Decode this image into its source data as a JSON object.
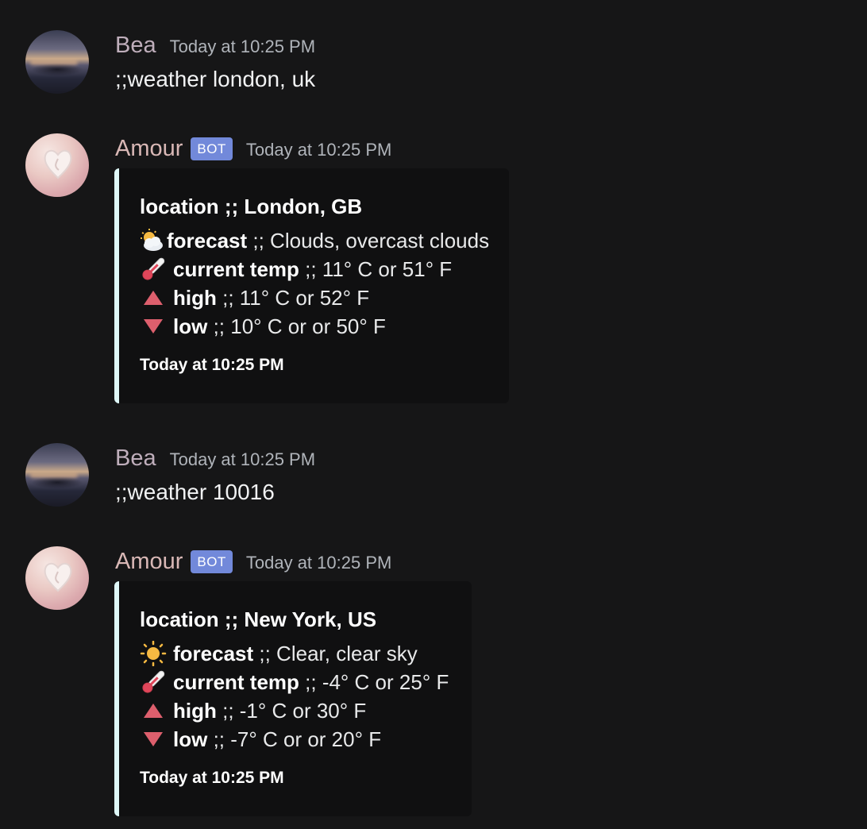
{
  "messages": [
    {
      "author": "Bea",
      "time": "Today at 10:25 PM",
      "text": ";;weather london, uk"
    },
    {
      "author": "Amour",
      "bot_tag": "BOT",
      "time": "Today at 10:25 PM",
      "embed": {
        "accent_color": "#dff8f8",
        "title": "location ;; London, GB",
        "forecast_label": "forecast",
        "forecast_value": " ;; Clouds, overcast clouds",
        "forecast_icon": "sun-behind-cloud-icon",
        "current_label": "current temp",
        "current_value": " ;; 11° C or 51° F",
        "high_label": "high",
        "high_value": " ;; 11° C or 52° F",
        "low_label": "low",
        "low_value": " ;; 10° C or or 50° F",
        "footer": "Today at 10:25 PM"
      }
    },
    {
      "author": "Bea",
      "time": "Today at 10:25 PM",
      "text": ";;weather 10016"
    },
    {
      "author": "Amour",
      "bot_tag": "BOT",
      "time": "Today at 10:25 PM",
      "embed": {
        "accent_color": "#dff8f8",
        "title": "location ;; New York, US",
        "forecast_label": "forecast",
        "forecast_value": " ;; Clear, clear sky",
        "forecast_icon": "sun-icon",
        "current_label": "current temp",
        "current_value": " ;; -4° C or 25° F",
        "high_label": "high",
        "high_value": " ;; -1° C or 30° F",
        "low_label": "low",
        "low_value": " ;; -7° C or or 20° F",
        "footer": "Today at 10:25 PM"
      }
    }
  ],
  "colors": {
    "background": "#161617",
    "embed_background": "#101011",
    "bot_tag": "#7289da",
    "triangle": "#dd5f6d"
  }
}
